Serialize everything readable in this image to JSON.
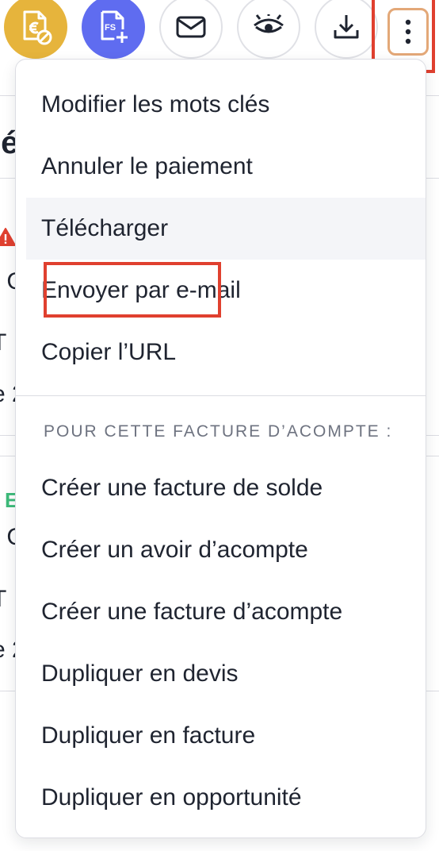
{
  "toolbar": {
    "buttons": [
      {
        "id": "payment",
        "icon": "euro-document-icon",
        "color": "#e6b43c"
      },
      {
        "id": "fs",
        "icon": "fs-add-document-icon",
        "label": "FS",
        "color": "#5f6cf0"
      },
      {
        "id": "email",
        "icon": "mail-icon"
      },
      {
        "id": "preview",
        "icon": "eye-icon"
      },
      {
        "id": "download",
        "icon": "download-icon"
      },
      {
        "id": "more",
        "icon": "more-vertical-icon"
      }
    ]
  },
  "menu": {
    "items": [
      {
        "label": "Modifier les mots clés"
      },
      {
        "label": "Annuler le paiement"
      },
      {
        "label": "Télécharger"
      },
      {
        "label": "Envoyer par e-mail"
      },
      {
        "label": "Copier l’URL"
      }
    ],
    "section_title": "POUR CETTE FACTURE D’ACOMPTE :",
    "section_items": [
      {
        "label": "Créer une facture de solde"
      },
      {
        "label": "Créer un avoir d’acompte"
      },
      {
        "label": "Créer une facture d’acompte"
      },
      {
        "label": "Dupliquer en devis"
      },
      {
        "label": "Dupliquer en facture"
      },
      {
        "label": "Dupliquer en opportunité"
      }
    ]
  },
  "background": {
    "heading_fragment": "ié",
    "badge_fragment": "E",
    "row_fragments": [
      "- C",
      "T",
      "e 2",
      "- C",
      "T",
      "e 2"
    ]
  },
  "colors": {
    "highlight": "#e0402f",
    "more_button_border": "#e3a878",
    "hover_bg": "#f4f5f8",
    "badge_green": "#3dbb7a",
    "warning_red": "#e0402f"
  }
}
